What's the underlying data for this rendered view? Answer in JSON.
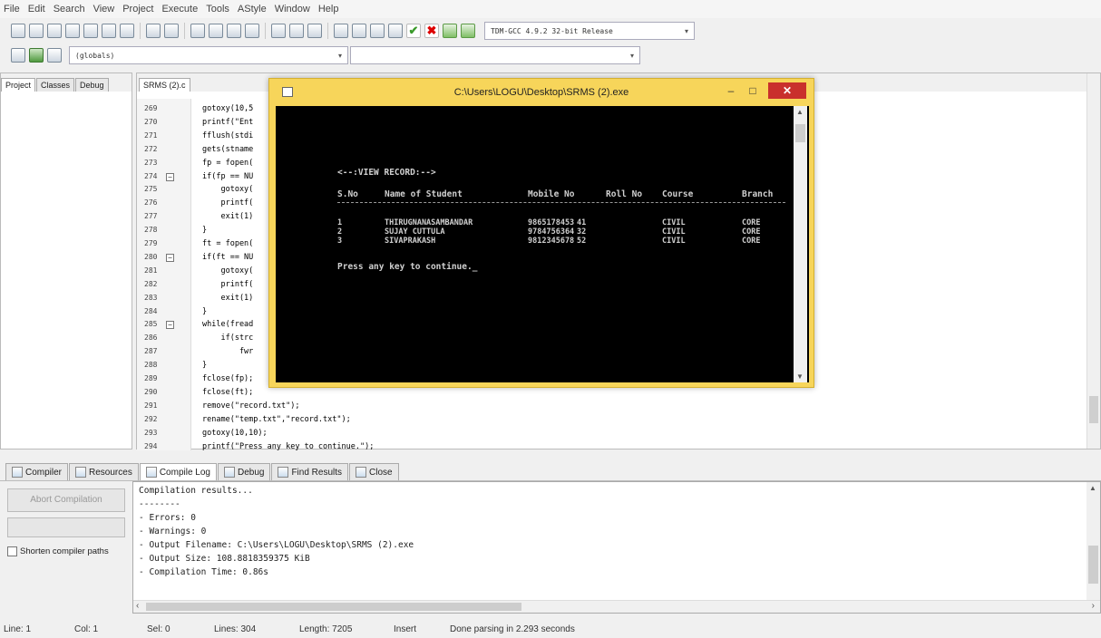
{
  "menu": [
    "File",
    "Edit",
    "Search",
    "View",
    "Project",
    "Execute",
    "Tools",
    "AStyle",
    "Window",
    "Help"
  ],
  "toolbar": {
    "compiler": "TDM-GCC 4.9.2 32-bit Release",
    "scope": "(globals)"
  },
  "left_tabs": [
    "Project",
    "Classes",
    "Debug"
  ],
  "editor": {
    "file_tab": "SRMS (2).c",
    "lines": [
      {
        "n": "269",
        "code": "gotoxy(10,5"
      },
      {
        "n": "270",
        "code": "printf(\"Ent"
      },
      {
        "n": "271",
        "code": "fflush(stdi"
      },
      {
        "n": "272",
        "code": "gets(stname"
      },
      {
        "n": "273",
        "code": "fp = fopen("
      },
      {
        "n": "274",
        "code": "if(fp == NU"
      },
      {
        "n": "275",
        "code": "    gotoxy("
      },
      {
        "n": "276",
        "code": "    printf("
      },
      {
        "n": "277",
        "code": "    exit(1)"
      },
      {
        "n": "278",
        "code": "}"
      },
      {
        "n": "279",
        "code": "ft = fopen("
      },
      {
        "n": "280",
        "code": "if(ft == NU"
      },
      {
        "n": "281",
        "code": "    gotoxy("
      },
      {
        "n": "282",
        "code": "    printf("
      },
      {
        "n": "283",
        "code": "    exit(1)"
      },
      {
        "n": "284",
        "code": "}"
      },
      {
        "n": "285",
        "code": "while(fread"
      },
      {
        "n": "286",
        "code": "    if(strc"
      },
      {
        "n": "287",
        "code": "        fwr"
      },
      {
        "n": "288",
        "code": "}"
      },
      {
        "n": "289",
        "code": "fclose(fp);"
      },
      {
        "n": "290",
        "code": "fclose(ft);"
      },
      {
        "n": "291",
        "code": "remove(\"record.txt\");"
      },
      {
        "n": "292",
        "code": "rename(\"temp.txt\",\"record.txt\");"
      },
      {
        "n": "293",
        "code": "gotoxy(10,10);"
      },
      {
        "n": "294",
        "code": "printf(\"Press any key to continue.\");"
      }
    ]
  },
  "console": {
    "title": "C:\\Users\\LOGU\\Desktop\\SRMS (2).exe",
    "heading": "<--:VIEW RECORD:-->",
    "columns": [
      "S.No",
      "Name of Student",
      "Mobile No",
      "Roll No",
      "Course",
      "Branch"
    ],
    "rows": [
      [
        "1",
        "THIRUGNANASAMBANDAR",
        "9865178453",
        "41",
        "CIVIL",
        "CORE"
      ],
      [
        "2",
        "SUJAY CUTTULA",
        "9784756364",
        "32",
        "CIVIL",
        "CORE"
      ],
      [
        "3",
        "SIVAPRAKASH",
        "9812345678",
        "52",
        "CIVIL",
        "CORE"
      ]
    ],
    "prompt": "Press any key to continue._"
  },
  "bottom_tabs": [
    "Compiler",
    "Resources",
    "Compile Log",
    "Debug",
    "Find Results",
    "Close"
  ],
  "log": {
    "abort_label": "Abort Compilation",
    "shorten_label": "Shorten compiler paths",
    "lines": [
      "Compilation results...",
      "--------",
      "- Errors: 0",
      "- Warnings: 0",
      "- Output Filename: C:\\Users\\LOGU\\Desktop\\SRMS (2).exe",
      "- Output Size: 108.8818359375 KiB",
      "- Compilation Time: 0.86s"
    ]
  },
  "status": {
    "line": "Line:   1",
    "col": "Col:   1",
    "sel": "Sel:   0",
    "lines": "Lines:  304",
    "length": "Length:  7205",
    "mode": "Insert",
    "message": "Done parsing in 2.293 seconds"
  },
  "colors": {
    "console_frame": "#f7d55a",
    "close_button": "#c9302c",
    "console_bg": "#000000"
  }
}
